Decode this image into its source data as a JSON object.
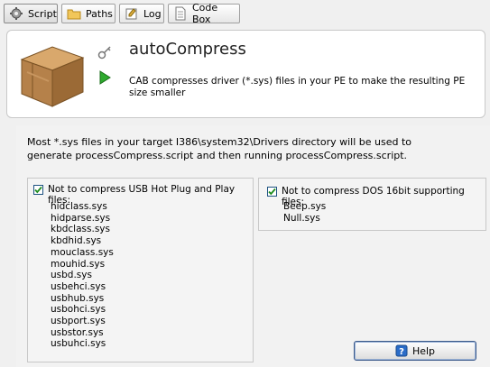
{
  "tabs": [
    {
      "label": "Script",
      "icon": "gear-icon",
      "active": true
    },
    {
      "label": "Paths",
      "icon": "folder-icon"
    },
    {
      "label": "Log",
      "icon": "log-icon"
    },
    {
      "label": "Code Box",
      "icon": "document-icon"
    }
  ],
  "header": {
    "title": "autoCompress",
    "description": "CAB compresses driver (*.sys) files in your PE to make the resulting PE size smaller"
  },
  "main": {
    "intro": "Most *.sys files in your target I386\\system32\\Drivers directory will be used to generate processCompress.script and then running processCompress.script.",
    "usb_group": {
      "checked": true,
      "label": "Not to compress USB Hot Plug and Play files:",
      "files": [
        "hidclass.sys",
        "hidparse.sys",
        "kbdclass.sys",
        "kbdhid.sys",
        "mouclass.sys",
        "mouhid.sys",
        "usbd.sys",
        "usbehci.sys",
        "usbhub.sys",
        "usbohci.sys",
        "usbport.sys",
        "usbstor.sys",
        "usbuhci.sys"
      ]
    },
    "dos_group": {
      "checked": true,
      "label": "Not to compress DOS 16bit supporting files:",
      "files": [
        "Beep.sys",
        "Null.sys"
      ]
    },
    "help_label": "Help"
  },
  "colors": {
    "checkmark": "#1e8c1e",
    "box_brown": "#b5814a",
    "play_green": "#2eaa2e"
  }
}
